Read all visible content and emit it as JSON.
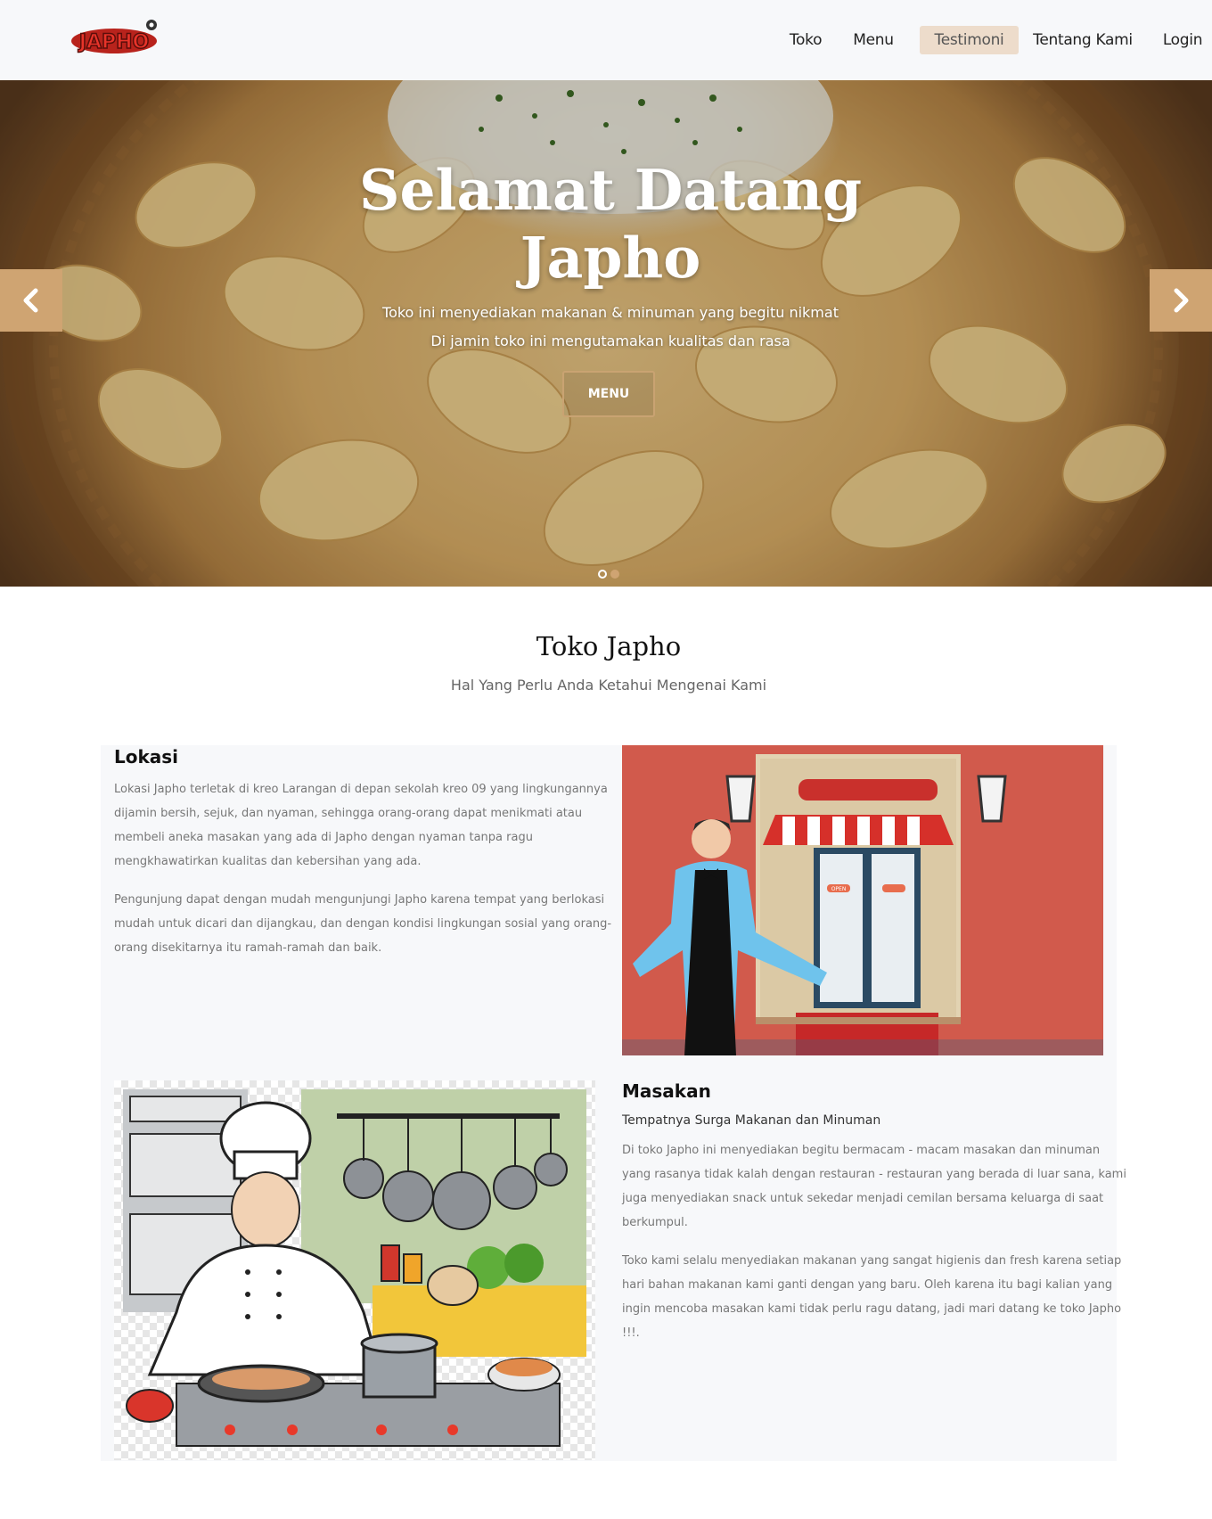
{
  "brand": {
    "logo_text": "JAPHO"
  },
  "nav": {
    "items": [
      {
        "label": "Toko",
        "active": false
      },
      {
        "label": "Menu",
        "active": false
      },
      {
        "label": "Testimoni",
        "active": true
      },
      {
        "label": "Tentang Kami",
        "active": false
      },
      {
        "label": "Login",
        "active": false
      }
    ]
  },
  "hero": {
    "title_line1": "Selamat Datang",
    "title_line2": "Japho",
    "subtitle_line1": "Toko ini menyediakan makanan & minuman yang begitu nikmat",
    "subtitle_line2": "Di jamin toko ini mengutamakan kualitas dan rasa",
    "button_label": "MENU",
    "prev_icon": "chevron-left-icon",
    "next_icon": "chevron-right-icon",
    "slides_total": 2,
    "active_slide": 1
  },
  "section": {
    "title": "Toko Japho",
    "subtitle": "Hal Yang Perlu Anda Ketahui Mengenai Kami"
  },
  "lokasi": {
    "heading": "Lokasi",
    "para1_lines": [
      "Lokasi Japho terletak di kreo Larangan di depan sekolah kreo 09 yang lingkungannya",
      "dijamin bersih, sejuk, dan nyaman, sehingga orang-orang dapat menikmati atau",
      "membeli aneka masakan yang ada di Japho dengan nyaman tanpa ragu",
      "mengkhawatirkan kualitas dan kebersihan yang ada."
    ],
    "para2_lines": [
      "Pengunjung dapat dengan mudah mengunjungi Japho karena tempat yang berlokasi",
      "mudah untuk dicari dan dijangkau, dan dengan kondisi lingkungan sosial yang orang-",
      "orang disekitarnya itu ramah-ramah dan baik."
    ],
    "image_sign": "OPEN"
  },
  "masakan": {
    "heading": "Masakan",
    "tagline": "Tempatnya Surga Makanan dan Minuman",
    "para1_lines": [
      "Di toko Japho ini menyediakan begitu bermacam - macam masakan dan minuman",
      "yang rasanya tidak kalah dengan restauran - restauran yang berada di luar sana, kami",
      "juga menyediakan snack untuk sekedar menjadi cemilan bersama keluarga di saat",
      "berkumpul."
    ],
    "para2_lines": [
      "Toko kami selalu menyediakan makanan yang sangat higienis dan fresh karena setiap",
      "hari bahan makanan kami ganti dengan yang baru. Oleh karena itu bagi kalian yang",
      "ingin mencoba masakan kami tidak perlu ragu datang, jadi mari datang ke toko Japho",
      "!!!."
    ]
  },
  "colors": {
    "accent": "#cfa472",
    "nav_active_bg": "#eddccb",
    "panel_bg": "#f7f8fa",
    "store_bg": "#d15a4c"
  }
}
